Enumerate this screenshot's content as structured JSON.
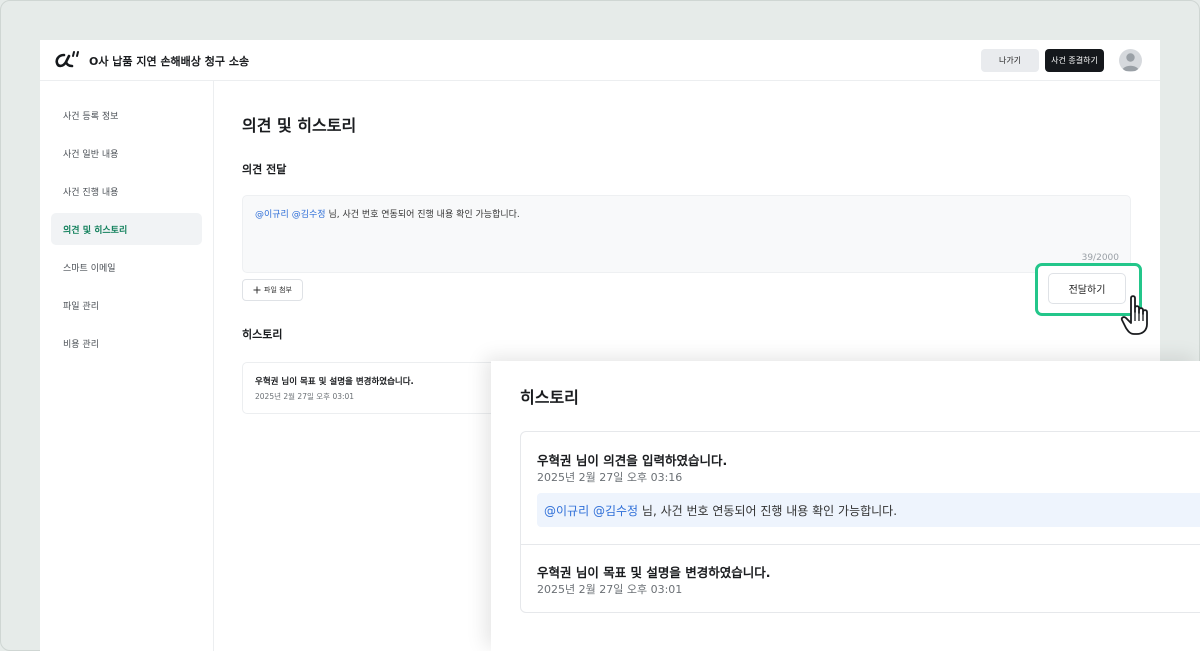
{
  "header": {
    "case_title": "O사 납품 지연 손해배상 청구 소송",
    "exit_label": "나가기",
    "close_case_label": "사건 종결하기"
  },
  "sidebar": {
    "items": [
      {
        "label": "사건 등록 정보",
        "active": false
      },
      {
        "label": "사건 일반 내용",
        "active": false
      },
      {
        "label": "사건 진행 내용",
        "active": false
      },
      {
        "label": "의견 및 히스토리",
        "active": true
      },
      {
        "label": "스마트 이메일",
        "active": false
      },
      {
        "label": "파일 관리",
        "active": false
      },
      {
        "label": "비용 관리",
        "active": false
      }
    ]
  },
  "main": {
    "page_title": "의견 및 히스토리",
    "opinion_section_title": "의견 전달",
    "opinion_input": {
      "mention1": "@이규리",
      "mention2": "@김수정",
      "text": "님, 사건 번호 연동되어 진행 내용 확인 가능합니다.",
      "char_count": "39/2000"
    },
    "attach_label": "파일 첨부",
    "send_label": "전달하기",
    "history_section_title": "히스토리",
    "history_items": [
      {
        "title": "우혁권 님이 목표 및 설명을 변경하였습니다.",
        "time": "2025년 2월 27일 오후 03:01"
      }
    ]
  },
  "zoom_panel": {
    "title": "히스토리",
    "items": [
      {
        "title": "우혁권 님이 의견을 입력하였습니다.",
        "time": "2025년 2월 27일 오후 03:16",
        "mention1": "@이규리",
        "mention2": "@김수정",
        "quote": "님, 사건 번호 연동되어 진행 내용 확인 가능합니다."
      },
      {
        "title": "우혁권 님이 목표 및 설명을 변경하였습니다.",
        "time": "2025년 2월 27일 오후 03:01"
      }
    ]
  },
  "colors": {
    "accent_green": "#23c68a",
    "active_nav_text": "#12805c",
    "mention_blue": "#2f6fd8",
    "primary_dark": "#15181c"
  }
}
